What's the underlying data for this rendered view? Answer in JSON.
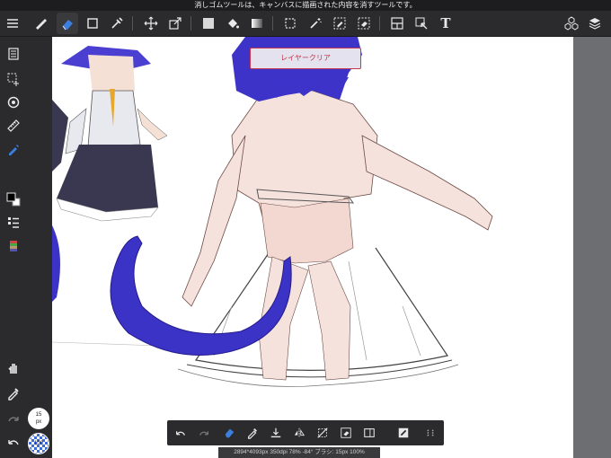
{
  "hint": "消しゴムツールは、キャンバスに描画された内容を消すツールです。",
  "toolbar": {
    "icons": [
      "menu-icon",
      "brush-icon",
      "eraser-icon",
      "shape-icon",
      "smudge-icon",
      "move-icon",
      "transform-icon",
      "fill-color-icon",
      "bucket-icon",
      "gradient-icon",
      "select-rect-icon",
      "magic-wand-icon",
      "select-pen-icon",
      "select-eraser-icon",
      "layout-icon",
      "select-move-icon",
      "text-icon",
      "materials-icon",
      "layers-icon"
    ],
    "text_tool_label": "T"
  },
  "layer_clear_button": "レイヤークリア",
  "brush_size": {
    "value": "15",
    "unit": "px"
  },
  "brush_opacity": "100",
  "status": "2894*4093px 350dpi 78% -84° ブラシ: 15px 100%",
  "colors": {
    "accent": "#3b7fe0",
    "clear_button_border": "#c23a4e",
    "fg_color": "#000000",
    "bg_color": "#ffffff"
  }
}
